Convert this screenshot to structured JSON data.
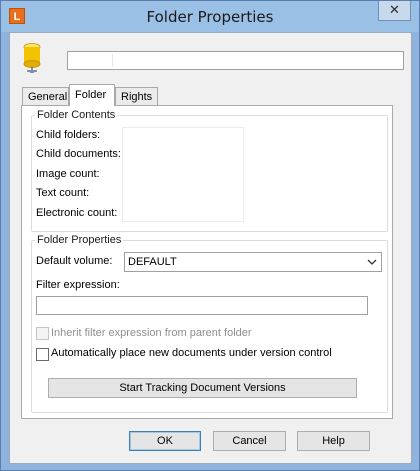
{
  "window": {
    "title": "Folder Properties",
    "app_icon_letter": "L",
    "close_label": "✕"
  },
  "header": {
    "folder_icon": "folder-database-icon",
    "name_value": ""
  },
  "tabs": [
    {
      "label": "General",
      "active": false
    },
    {
      "label": "Folder",
      "active": true
    },
    {
      "label": "Rights",
      "active": false
    }
  ],
  "folder_contents": {
    "title": "Folder Contents",
    "rows": [
      {
        "label": "Child folders:",
        "value": ""
      },
      {
        "label": "Child documents:",
        "value": ""
      },
      {
        "label": "Image count:",
        "value": ""
      },
      {
        "label": "Text count:",
        "value": ""
      },
      {
        "label": "Electronic count:",
        "value": ""
      }
    ]
  },
  "folder_properties": {
    "title": "Folder Properties",
    "default_volume_label": "Default volume:",
    "default_volume_value": "DEFAULT",
    "filter_expression_label": "Filter expression:",
    "filter_expression_value": "",
    "inherit_label": "Inherit filter expression from parent folder",
    "inherit_checked": false,
    "inherit_enabled": false,
    "auto_version_label": "Automatically place new documents under version control",
    "auto_version_checked": false,
    "tracking_button_label": "Start Tracking Document Versions"
  },
  "footer": {
    "ok_label": "OK",
    "cancel_label": "Cancel",
    "help_label": "Help"
  },
  "colors": {
    "titlebar": "#9bc0e6",
    "app_icon": "#e8701c",
    "folder_icon": "#f2c200"
  }
}
